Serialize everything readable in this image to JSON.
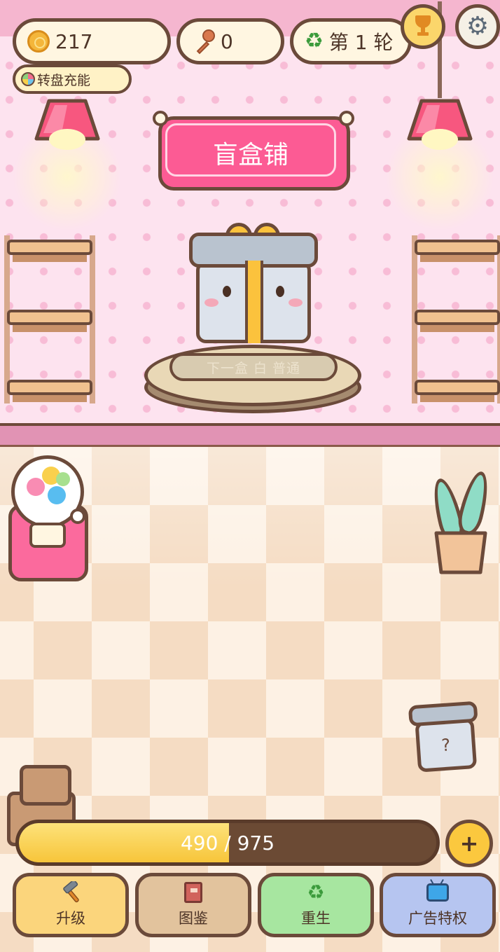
{
  "hud": {
    "coins": "217",
    "keys": "0",
    "round_label": "第 1 轮",
    "wheel_label": "转盘充能"
  },
  "shop": {
    "sign_title": "盲盒铺",
    "next_box_label": "下一盒 白 普通"
  },
  "jar": {
    "mark": "?"
  },
  "progress": {
    "current": 490,
    "max": 975,
    "text": "490 / 975",
    "fraction": 0.503
  },
  "plus_label": "+",
  "nav": {
    "upgrade": "升级",
    "collection": "图鉴",
    "rebirth": "重生",
    "ads": "广告特权"
  },
  "icons": {
    "coin": "coin-icon",
    "key": "key-icon",
    "round": "recycle-icon",
    "trophy": "trophy-icon",
    "settings": "gear-icon",
    "wheel": "wheel-icon",
    "upgrade": "hammer-icon",
    "collection": "book-icon",
    "rebirth": "recycle-icon",
    "ads": "tv-icon"
  },
  "colors": {
    "outline": "#6b4a3a",
    "wall": "#fde3ef",
    "sign": "#fc5b94",
    "progress_fill": "#f7c53a",
    "nav_upgrade": "#fbd57c",
    "nav_collection": "#e2c39d",
    "nav_rebirth": "#a7e6a0",
    "nav_ads": "#b6c5f0"
  }
}
